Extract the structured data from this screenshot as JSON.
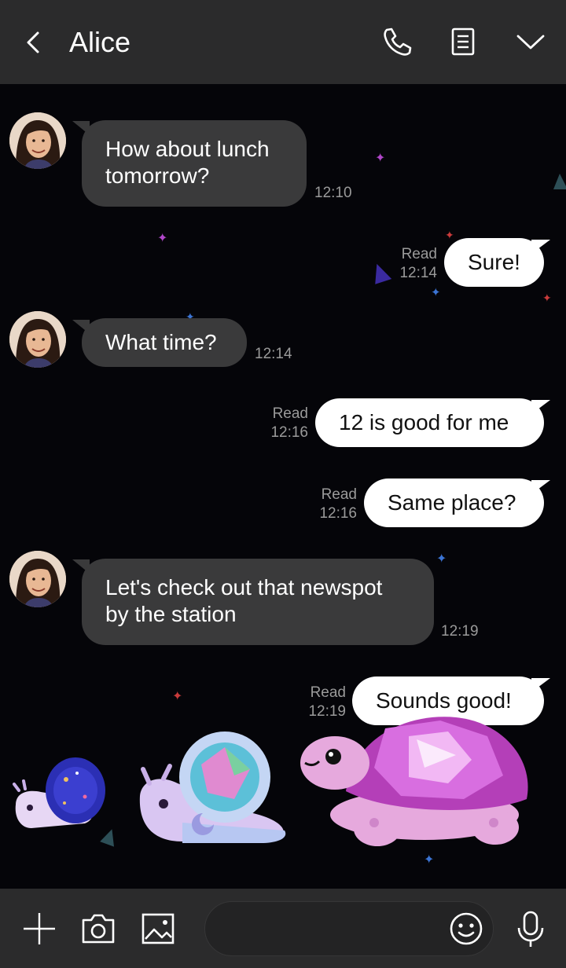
{
  "header": {
    "title": "Alice",
    "back_icon": "back-chevron-icon",
    "call_icon": "phone-icon",
    "notes_icon": "note-icon",
    "menu_icon": "chevron-down-icon"
  },
  "messages": [
    {
      "direction": "in",
      "lines": [
        "How about lunch",
        "tomorrow?"
      ],
      "time": "12:10"
    },
    {
      "direction": "out",
      "lines": [
        "Sure!"
      ],
      "read": "Read",
      "time": "12:14"
    },
    {
      "direction": "in",
      "lines": [
        "What time?"
      ],
      "time": "12:14"
    },
    {
      "direction": "out",
      "lines": [
        "12 is good for me"
      ],
      "read": "Read",
      "time": "12:16"
    },
    {
      "direction": "out",
      "lines": [
        "Same place?"
      ],
      "read": "Read",
      "time": "12:16"
    },
    {
      "direction": "in",
      "lines": [
        "Let's check out that newspot",
        "by the station"
      ],
      "time": "12:19"
    },
    {
      "direction": "out",
      "lines": [
        "Sounds good!"
      ],
      "read": "Read",
      "time": "12:19"
    }
  ],
  "footer": {
    "plus_icon": "plus-icon",
    "camera_icon": "camera-icon",
    "image_icon": "image-icon",
    "emoji_icon": "emoji-icon",
    "mic_icon": "microphone-icon",
    "input_value": "",
    "input_placeholder": ""
  },
  "theme": {
    "background": "#050509",
    "bar": "#2b2b2c",
    "bubble_in": "#3a3a3b",
    "bubble_out": "#ffffff"
  }
}
